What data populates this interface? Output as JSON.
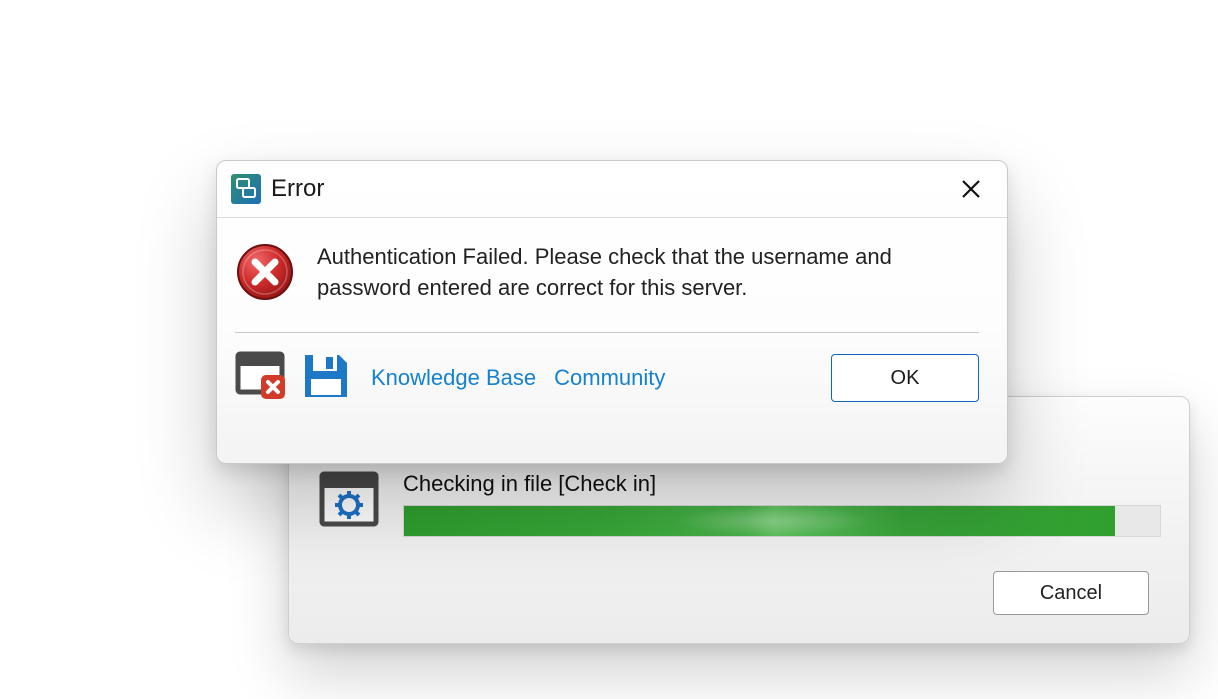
{
  "progress_dialog": {
    "status_text": "Checking in file [Check in]",
    "progress_percent": 94,
    "cancel_label": "Cancel"
  },
  "error_dialog": {
    "title": "Error",
    "message": "Authentication Failed. Please check that the username and password entered are correct for this server.",
    "links": {
      "knowledge_base": "Knowledge Base",
      "community": "Community"
    },
    "ok_label": "OK"
  }
}
